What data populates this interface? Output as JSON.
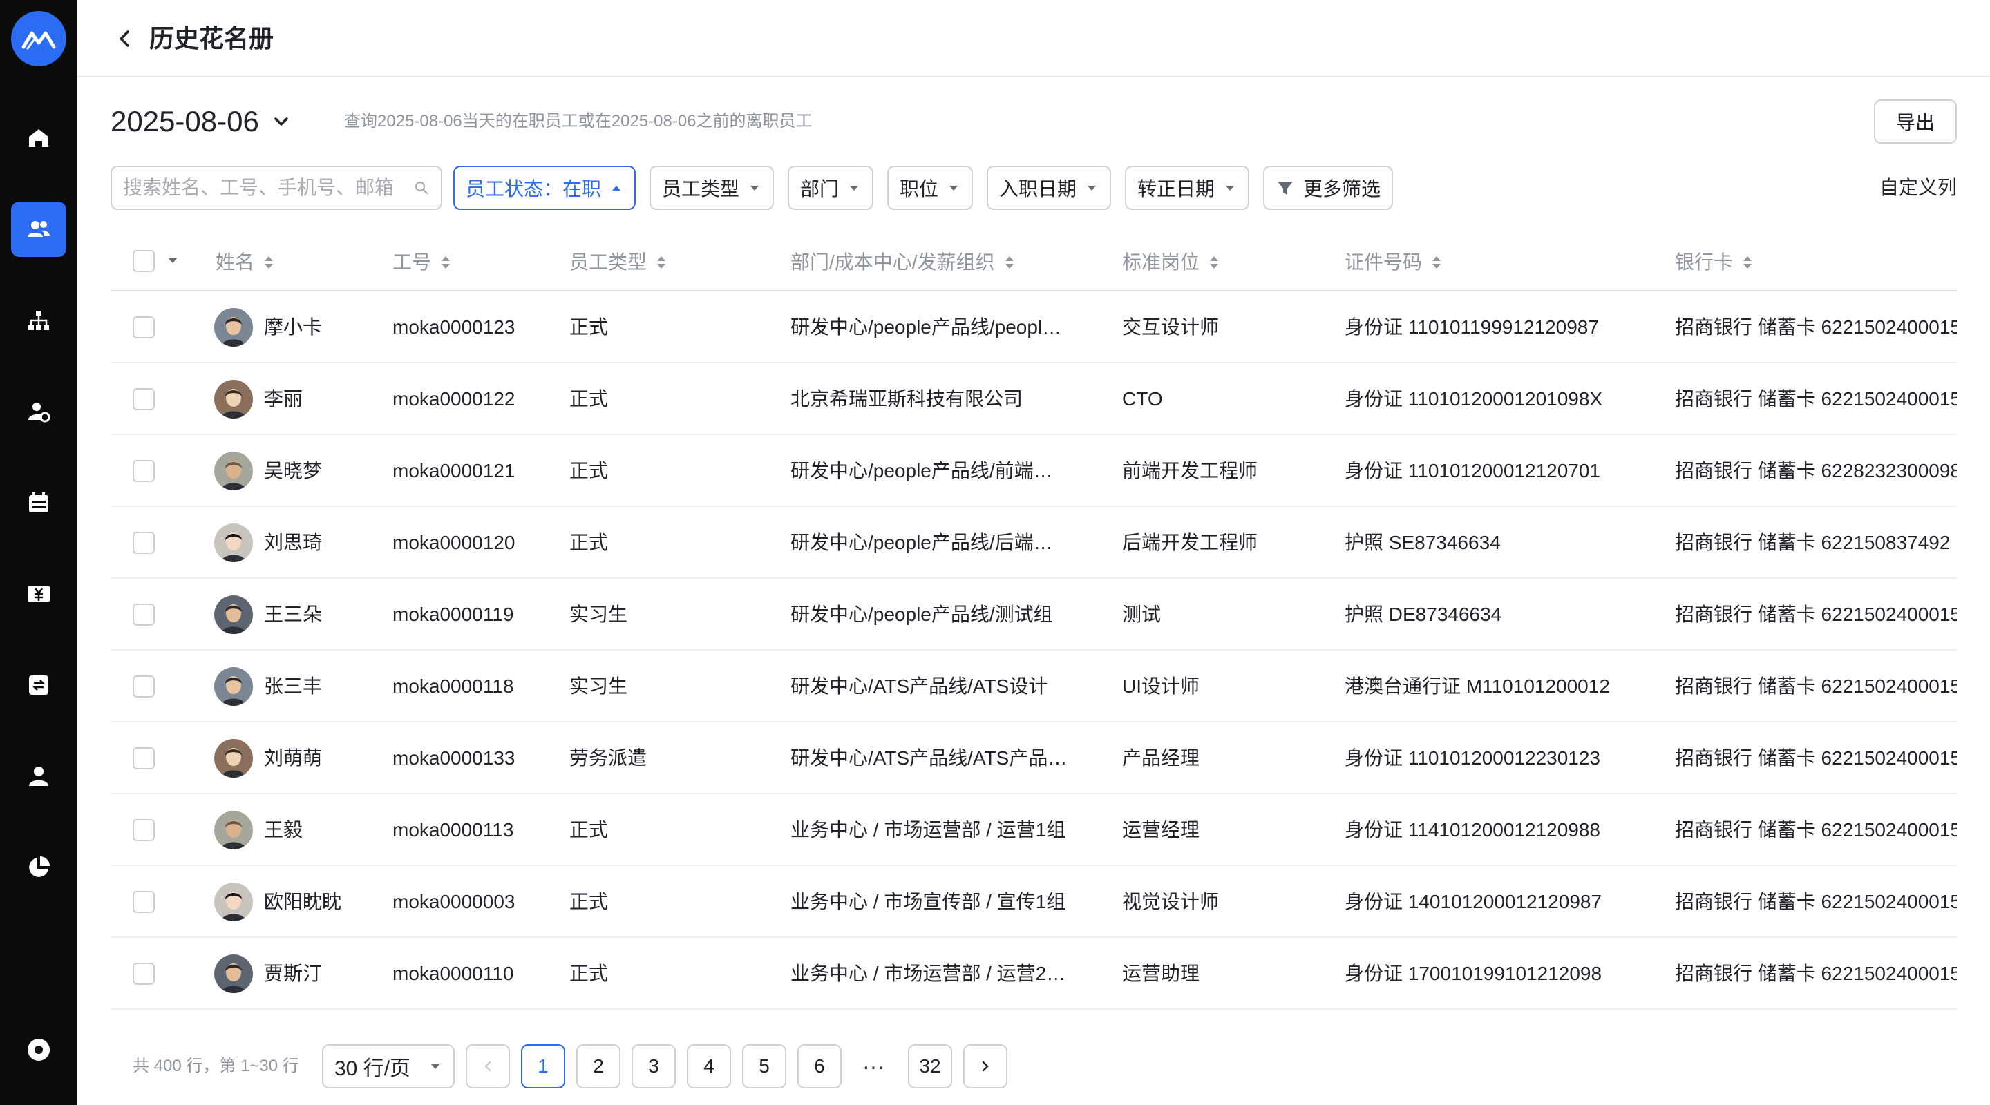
{
  "header": {
    "title": "历史花名册"
  },
  "date": {
    "value": "2025-08-06",
    "hint": "查询2025-08-06当天的在职员工或在2025-08-06之前的离职员工"
  },
  "toolbar": {
    "export_label": "导出",
    "custom_columns_label": "自定义列"
  },
  "search": {
    "placeholder": "搜索姓名、工号、手机号、邮箱",
    "value": ""
  },
  "filters": [
    {
      "label": "员工状态：在职",
      "active": true
    },
    {
      "label": "员工类型",
      "active": false
    },
    {
      "label": "部门",
      "active": false
    },
    {
      "label": "职位",
      "active": false
    },
    {
      "label": "入职日期",
      "active": false
    },
    {
      "label": "转正日期",
      "active": false
    },
    {
      "label": "更多筛选",
      "active": false,
      "icon": "filter-icon"
    }
  ],
  "table": {
    "columns": [
      "姓名",
      "工号",
      "员工类型",
      "部门/成本中心/发薪组织",
      "标准岗位",
      "证件号码",
      "银行卡"
    ],
    "rows": [
      {
        "name": "摩小卡",
        "id": "moka0000123",
        "type": "正式",
        "dept": "研发中心/people产品线/peopl…",
        "position": "交互设计师",
        "cert": "身份证 110101199912120987",
        "bank": "招商银行 储蓄卡 6221502400015"
      },
      {
        "name": "李丽",
        "id": "moka0000122",
        "type": "正式",
        "dept": "北京希瑞亚斯科技有限公司",
        "position": "CTO",
        "cert": "身份证 11010120001201098X",
        "bank": "招商银行 储蓄卡 6221502400015"
      },
      {
        "name": "吴晓梦",
        "id": "moka0000121",
        "type": "正式",
        "dept": "研发中心/people产品线/前端…",
        "position": "前端开发工程师",
        "cert": "身份证 110101200012120701",
        "bank": "招商银行 储蓄卡 6228232300098"
      },
      {
        "name": "刘思琦",
        "id": "moka0000120",
        "type": "正式",
        "dept": "研发中心/people产品线/后端…",
        "position": "后端开发工程师",
        "cert": "护照 SE87346634",
        "bank": "招商银行 储蓄卡 622150837492"
      },
      {
        "name": "王三朵",
        "id": "moka0000119",
        "type": "实习生",
        "dept": "研发中心/people产品线/测试组",
        "position": "测试",
        "cert": "护照 DE87346634",
        "bank": "招商银行 储蓄卡 6221502400015"
      },
      {
        "name": "张三丰",
        "id": "moka0000118",
        "type": "实习生",
        "dept": "研发中心/ATS产品线/ATS设计",
        "position": "UI设计师",
        "cert": "港澳台通行证 M110101200012",
        "bank": "招商银行 储蓄卡 6221502400015"
      },
      {
        "name": "刘萌萌",
        "id": "moka0000133",
        "type": "劳务派遣",
        "dept": "研发中心/ATS产品线/ATS产品…",
        "position": "产品经理",
        "cert": "身份证 110101200012230123",
        "bank": "招商银行 储蓄卡 6221502400015"
      },
      {
        "name": "王毅",
        "id": "moka0000113",
        "type": "正式",
        "dept": "业务中心 / 市场运营部 / 运营1组",
        "position": "运营经理",
        "cert": "身份证 114101200012120988",
        "bank": "招商银行 储蓄卡 6221502400015"
      },
      {
        "name": "欧阳眈眈",
        "id": "moka0000003",
        "type": "正式",
        "dept": "业务中心 / 市场宣传部 / 宣传1组",
        "position": "视觉设计师",
        "cert": "身份证 140101200012120987",
        "bank": "招商银行 储蓄卡 6221502400015"
      },
      {
        "name": "贾斯汀",
        "id": "moka0000110",
        "type": "正式",
        "dept": "业务中心 / 市场运营部 / 运营2…",
        "position": "运营助理",
        "cert": "身份证 170010199101212098",
        "bank": "招商银行 储蓄卡 6221502400015"
      }
    ]
  },
  "pagination": {
    "total_text": "共 400 行，第 1~30 行",
    "page_size": "30 行/页",
    "pages": [
      "1",
      "2",
      "3",
      "4",
      "5",
      "6"
    ],
    "ellipsis": "···",
    "last_page": "32",
    "current": "1"
  },
  "colors": {
    "accent": "#2b6cf3",
    "sidebar": "#0b0b0c"
  }
}
